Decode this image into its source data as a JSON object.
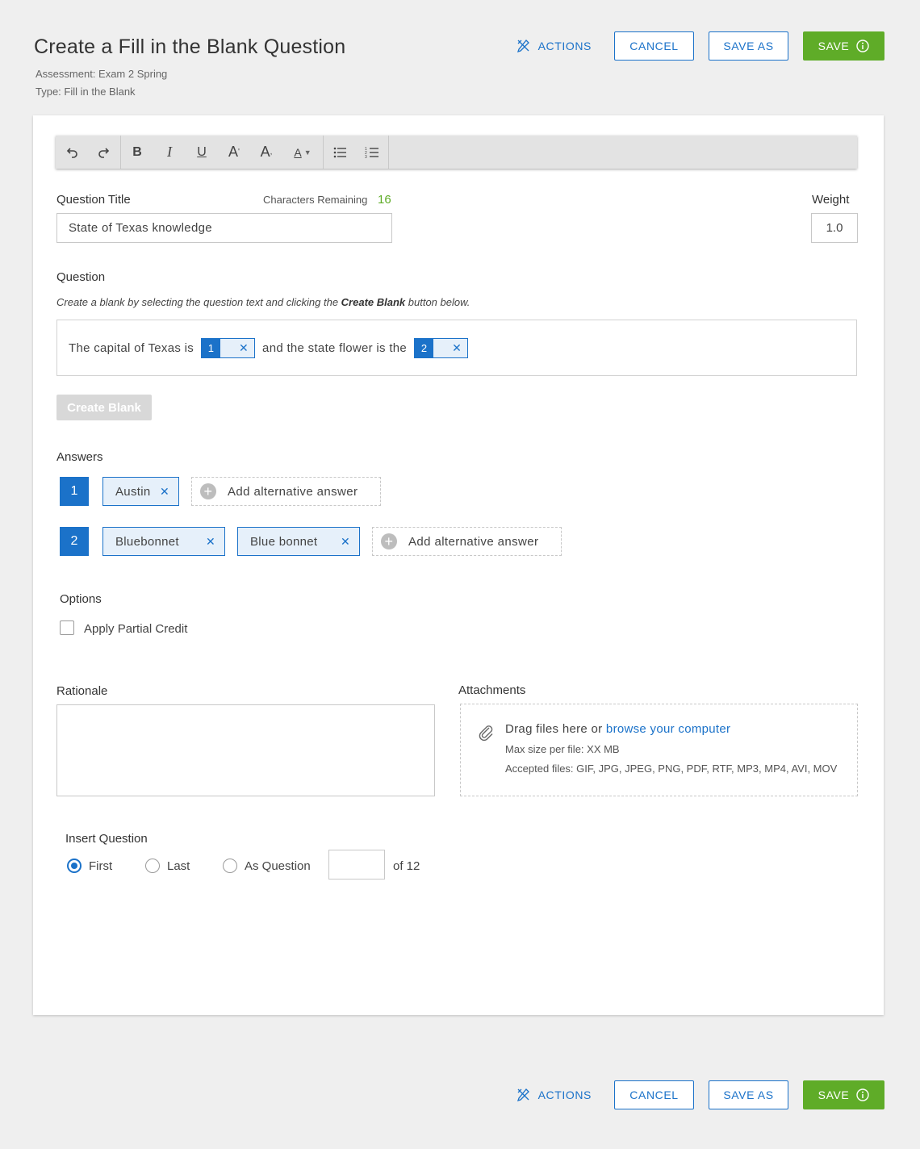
{
  "header": {
    "title": "Create a Fill in the Blank Question",
    "assessment": "Assessment: Exam 2 Spring",
    "type": "Type: Fill in the Blank"
  },
  "actions_bar": {
    "actions_label": "ACTIONS",
    "cancel_label": "CANCEL",
    "save_as_label": "SAVE AS",
    "save_label": "SAVE"
  },
  "toolbar": {
    "icons": [
      "undo-icon",
      "redo-icon",
      "bold-icon",
      "italic-icon",
      "underline-icon",
      "superscript-icon",
      "subscript-icon",
      "font-color-icon",
      "bullet-list-icon",
      "numbered-list-icon"
    ]
  },
  "question_title": {
    "label": "Question Title",
    "chars_label": "Characters Remaining",
    "chars_remaining": "16",
    "value": "State of Texas knowledge"
  },
  "weight": {
    "label": "Weight",
    "value": "1.0"
  },
  "question": {
    "label": "Question",
    "hint_before": "Create a blank by selecting the question text and clicking the ",
    "hint_bold": "Create Blank",
    "hint_after": " button below.",
    "text_part1": "The capital of Texas is",
    "blank1": "1",
    "text_part2": "and the state flower is the",
    "blank2": "2",
    "create_blank_label": "Create Blank"
  },
  "answers": {
    "label": "Answers",
    "rows": [
      {
        "number": "1",
        "answers": [
          "Austin"
        ],
        "add_label": "Add alternative answer"
      },
      {
        "number": "2",
        "answers": [
          "Bluebonnet",
          "Blue bonnet"
        ],
        "add_label": "Add alternative answer"
      }
    ]
  },
  "options": {
    "label": "Options",
    "partial_credit_label": "Apply Partial Credit",
    "partial_credit_checked": false
  },
  "rationale": {
    "label": "Rationale",
    "value": ""
  },
  "attachments": {
    "label": "Attachments",
    "drag_text": "Drag files here or ",
    "browse_link": "browse your computer",
    "max_size": "Max size per file: XX MB",
    "accepted": "Accepted files: GIF, JPG, JPEG, PNG, PDF, RTF, MP3, MP4, AVI, MOV"
  },
  "insert_question": {
    "label": "Insert Question",
    "options": [
      "First",
      "Last",
      "As Question"
    ],
    "selected": "First",
    "position_value": "",
    "of_total": "of 12"
  },
  "colors": {
    "accent": "#1b72c9",
    "save_green": "#5fac28",
    "chars_remaining_green": "#5fac28"
  }
}
